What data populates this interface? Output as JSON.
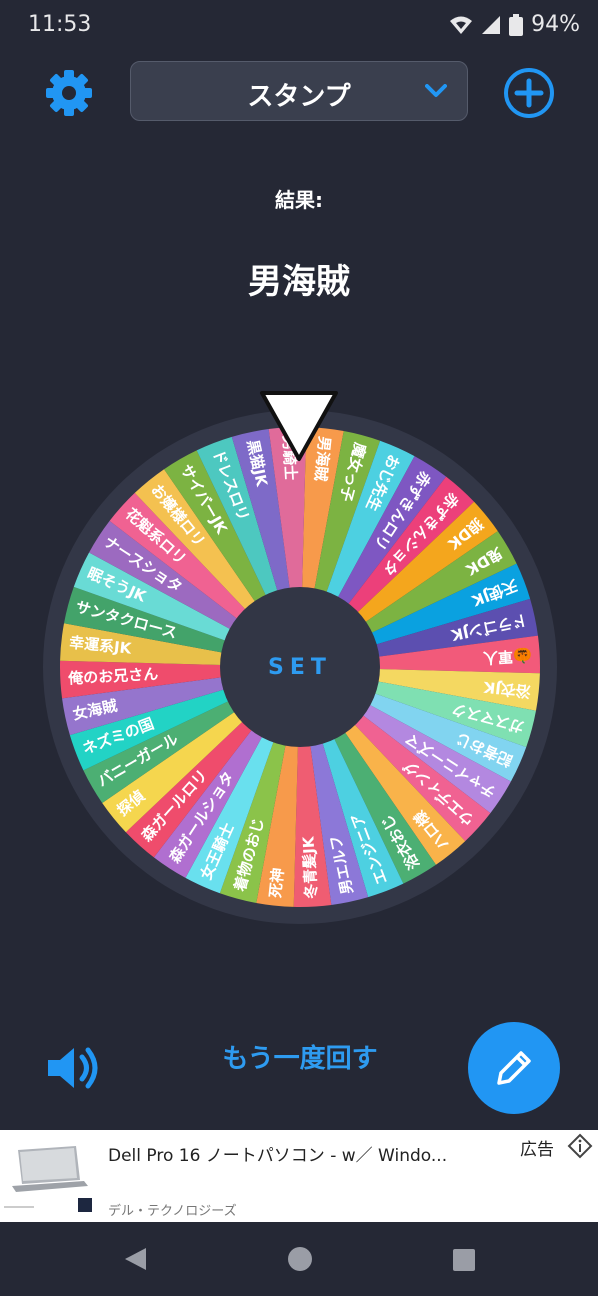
{
  "status_bar": {
    "time": "11:53",
    "battery": "94%"
  },
  "header": {
    "category": "スタンプ",
    "settings_icon": "gear-icon",
    "add_icon": "plus-circle-icon"
  },
  "result": {
    "label": "結果:",
    "value": "男海賊"
  },
  "wheel": {
    "center_label": "SET",
    "segments": [
      {
        "label": "男海賊",
        "color": "#f79a4b"
      },
      {
        "label": "魔女っ子",
        "color": "#7cb342"
      },
      {
        "label": "おじ先生",
        "color": "#4dd0e1"
      },
      {
        "label": "赤ずきんロリ",
        "color": "#7e57c2"
      },
      {
        "label": "赤ずきんショタ",
        "color": "#ec407a"
      },
      {
        "label": "狼DK",
        "color": "#f4a61d"
      },
      {
        "label": "鬼DK",
        "color": "#7cb342"
      },
      {
        "label": "天使JK",
        "color": "#0aa1e0"
      },
      {
        "label": "ドラゴンJK",
        "color": "#5c4fb0"
      },
      {
        "label": "🎃軍人",
        "color": "#f25a7a"
      },
      {
        "label": "浴衣JK",
        "color": "#f4d861"
      },
      {
        "label": "ガスマスク",
        "color": "#7fe0b2"
      },
      {
        "label": "記者おじ",
        "color": "#81d4f0"
      },
      {
        "label": "チャイニーズマ",
        "color": "#b388e0"
      },
      {
        "label": "ウエディング",
        "color": "#f06292"
      },
      {
        "label": "ハロ様",
        "color": "#f9b34a"
      },
      {
        "label": "浴衣おじ",
        "color": "#4caf73"
      },
      {
        "label": "エンジニア",
        "color": "#4dd0e1"
      },
      {
        "label": "男エルフ",
        "color": "#8c78d8"
      },
      {
        "label": "冬青髪JK",
        "color": "#ef5d72"
      },
      {
        "label": "死神",
        "color": "#f79a4b"
      },
      {
        "label": "着物のおじ",
        "color": "#8bc34a"
      },
      {
        "label": "女王騎士",
        "color": "#69e0ee"
      },
      {
        "label": "森ガールショタ",
        "color": "#b06fd0"
      },
      {
        "label": "森ガールロリ",
        "color": "#ef4c6c"
      },
      {
        "label": "探偵",
        "color": "#f5d64e"
      },
      {
        "label": "バニーガール",
        "color": "#4caf73"
      },
      {
        "label": "ネズミの国",
        "color": "#22d3c5"
      },
      {
        "label": "女海賊",
        "color": "#9575cd"
      },
      {
        "label": "俺のお兄さん",
        "color": "#ef4c6c"
      },
      {
        "label": "幸運系JK",
        "color": "#e8c04a"
      },
      {
        "label": "サンタクロース",
        "color": "#43a36a"
      },
      {
        "label": "眠そうJK",
        "color": "#69dbd5"
      },
      {
        "label": "ナースショタ",
        "color": "#9c6ac0"
      },
      {
        "label": "花魁系ロリ",
        "color": "#f06292"
      },
      {
        "label": "お嬢様ロリ",
        "color": "#f4c150"
      },
      {
        "label": "サイバーJK",
        "color": "#7cb342"
      },
      {
        "label": "ドレスロリ",
        "color": "#4dc8c0"
      },
      {
        "label": "黒猫JK",
        "color": "#7e6ac8"
      },
      {
        "label": "男騎士",
        "color": "#e06b9a"
      }
    ]
  },
  "controls": {
    "spin_again": "もう一度回す",
    "sound_icon": "speaker-icon",
    "edit_icon": "pencil-icon"
  },
  "ad": {
    "title": "Dell Pro 16 ノートパソコン - w／ Windo...",
    "advertiser": "デル・テクノロジーズ",
    "label": "広告"
  }
}
